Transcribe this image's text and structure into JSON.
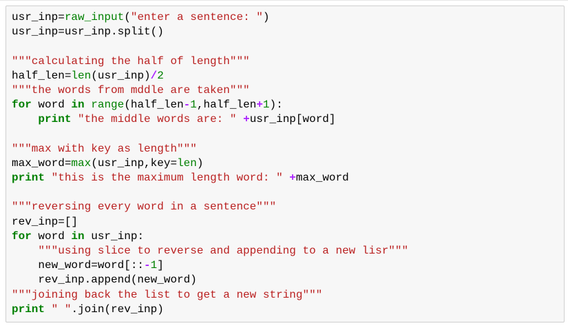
{
  "colors": {
    "keyword": "#008000",
    "builtin": "#008000",
    "number": "#008000",
    "operator": "#aa22ff",
    "string": "#ba2121",
    "text": "#000000",
    "cell_background": "#f7f7f7",
    "cell_border": "#cfcfcf"
  },
  "code": {
    "lines": [
      [
        {
          "t": "usr_inp=",
          "k": "txt"
        },
        {
          "t": "raw_input",
          "k": "bi"
        },
        {
          "t": "(",
          "k": "txt"
        },
        {
          "t": "\"enter a sentence: \"",
          "k": "str"
        },
        {
          "t": ")",
          "k": "txt"
        }
      ],
      [
        {
          "t": "usr_inp=usr_inp.split()",
          "k": "txt"
        }
      ],
      [],
      [
        {
          "t": "\"\"\"calculating the half of length\"\"\"",
          "k": "str"
        }
      ],
      [
        {
          "t": "half_len=",
          "k": "txt"
        },
        {
          "t": "len",
          "k": "bi"
        },
        {
          "t": "(usr_inp)",
          "k": "txt"
        },
        {
          "t": "/",
          "k": "op"
        },
        {
          "t": "2",
          "k": "num"
        }
      ],
      [
        {
          "t": "\"\"\"the words from mddle are taken\"\"\"",
          "k": "str"
        }
      ],
      [
        {
          "t": "for",
          "k": "kw"
        },
        {
          "t": " word ",
          "k": "txt"
        },
        {
          "t": "in",
          "k": "kw"
        },
        {
          "t": " ",
          "k": "txt"
        },
        {
          "t": "range",
          "k": "bi"
        },
        {
          "t": "(half_len",
          "k": "txt"
        },
        {
          "t": "-",
          "k": "op"
        },
        {
          "t": "1",
          "k": "num"
        },
        {
          "t": ",half_len",
          "k": "txt"
        },
        {
          "t": "+",
          "k": "op"
        },
        {
          "t": "1",
          "k": "num"
        },
        {
          "t": "):",
          "k": "txt"
        }
      ],
      [
        {
          "t": "    ",
          "k": "txt"
        },
        {
          "t": "print",
          "k": "kw"
        },
        {
          "t": " ",
          "k": "txt"
        },
        {
          "t": "\"the middle words are: \"",
          "k": "str"
        },
        {
          "t": " ",
          "k": "txt"
        },
        {
          "t": "+",
          "k": "op"
        },
        {
          "t": "usr_inp[word]",
          "k": "txt"
        }
      ],
      [],
      [
        {
          "t": "\"\"\"max with key as length\"\"\"",
          "k": "str"
        }
      ],
      [
        {
          "t": "max_word=",
          "k": "txt"
        },
        {
          "t": "max",
          "k": "bi"
        },
        {
          "t": "(usr_inp,key=",
          "k": "txt"
        },
        {
          "t": "len",
          "k": "bi"
        },
        {
          "t": ")",
          "k": "txt"
        }
      ],
      [
        {
          "t": "print",
          "k": "kw"
        },
        {
          "t": " ",
          "k": "txt"
        },
        {
          "t": "\"this is the maximum length word: \"",
          "k": "str"
        },
        {
          "t": " ",
          "k": "txt"
        },
        {
          "t": "+",
          "k": "op"
        },
        {
          "t": "max_word",
          "k": "txt"
        }
      ],
      [],
      [
        {
          "t": "\"\"\"reversing every word in a sentence\"\"\"",
          "k": "str"
        }
      ],
      [
        {
          "t": "rev_inp=[]",
          "k": "txt"
        }
      ],
      [
        {
          "t": "for",
          "k": "kw"
        },
        {
          "t": " word ",
          "k": "txt"
        },
        {
          "t": "in",
          "k": "kw"
        },
        {
          "t": " usr_inp:",
          "k": "txt"
        }
      ],
      [
        {
          "t": "    ",
          "k": "txt"
        },
        {
          "t": "\"\"\"using slice to reverse and appending to a new lisr\"\"\"",
          "k": "str"
        }
      ],
      [
        {
          "t": "    new_word=word[::",
          "k": "txt"
        },
        {
          "t": "-",
          "k": "op"
        },
        {
          "t": "1",
          "k": "num"
        },
        {
          "t": "]",
          "k": "txt"
        }
      ],
      [
        {
          "t": "    rev_inp.append(new_word)",
          "k": "txt"
        }
      ],
      [
        {
          "t": "\"\"\"joining back the list to get a new string\"\"\"",
          "k": "str"
        }
      ],
      [
        {
          "t": "print",
          "k": "kw"
        },
        {
          "t": " ",
          "k": "txt"
        },
        {
          "t": "\" \"",
          "k": "str"
        },
        {
          "t": ".join(rev_inp)",
          "k": "txt"
        }
      ]
    ]
  }
}
